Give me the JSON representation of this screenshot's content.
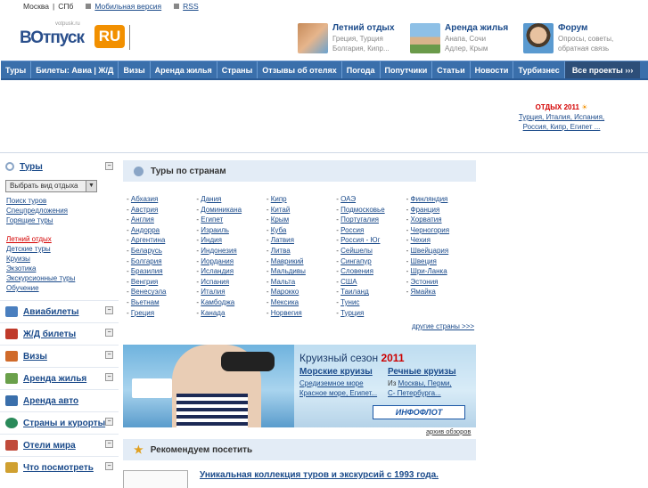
{
  "topbar": {
    "city": "Москва",
    "city_alt": "СПб",
    "mobile": "Мобильная версия",
    "rss": "RSS"
  },
  "logo": {
    "domain": "votpusk.ru",
    "word": "ВОтпуск",
    "box": "RU"
  },
  "promos": [
    {
      "title": "Летний отдых",
      "sub1": "Греция, Турция",
      "sub2": "Болгария, Кипр..."
    },
    {
      "title": "Аренда жилья",
      "sub1": "Анапа, Сочи",
      "sub2": "Адлер, Крым"
    },
    {
      "title": "Форум",
      "sub1": "Опросы, советы,",
      "sub2": "обратная связь"
    }
  ],
  "nav": [
    "Туры",
    "Билеты: Авиа | Ж/Д",
    "Визы",
    "Аренда жилья",
    "Страны",
    "Отзывы об отелях",
    "Погода",
    "Попутчики",
    "Статьи",
    "Новости",
    "Турбизнес"
  ],
  "nav_all": "Все проекты ›››",
  "ad": {
    "title": "ОТДЫХ 2011",
    "line1": "Турция, Италия, Испания,",
    "line2": "Россия, Кипр, Египет ..."
  },
  "sidebar": {
    "tours": "Туры",
    "select": "Выбрать вид отдыха",
    "links1": [
      "Поиск туров",
      "Спецпредложения",
      "Горящие туры"
    ],
    "links2": [
      "Летний отдых",
      "Детские туры",
      "Круизы",
      "Экзотика",
      "Экскурсионные туры",
      "Обучение"
    ],
    "sections": [
      "Авиабилеты",
      "Ж/Д билеты",
      "Визы",
      "Аренда жилья",
      "Аренда авто",
      "Страны и курорты",
      "Отели мира",
      "Что посмотреть"
    ]
  },
  "tours_panel": {
    "title": "Туры по странам",
    "columns": [
      [
        "Абхазия",
        "Австрия",
        "Англия",
        "Андорра",
        "Аргентина",
        "Беларусь",
        "Болгария",
        "Бразилия",
        "Венгрия",
        "Венесуэла",
        "Вьетнам",
        "Греция"
      ],
      [
        "Дания",
        "Доминикана",
        "Египет",
        "Израиль",
        "Индия",
        "Индонезия",
        "Иордания",
        "Исландия",
        "Испания",
        "Италия",
        "Камбоджа",
        "Канада"
      ],
      [
        "Кипр",
        "Китай",
        "Крым",
        "Куба",
        "Латвия",
        "Литва",
        "Маврикий",
        "Мальдивы",
        "Мальта",
        "Марокко",
        "Мексика",
        "Норвегия"
      ],
      [
        "ОАЭ",
        "Подмосковье",
        "Португалия",
        "Россия",
        "Россия - Юг",
        "Сейшелы",
        "Сингапур",
        "Словения",
        "США",
        "Таиланд",
        "Тунис",
        "Турция"
      ],
      [
        "Финляндия",
        "Франция",
        "Хорватия",
        "Черногория",
        "Чехия",
        "Швейцария",
        "Швеция",
        "Шри-Ланка",
        "Эстония",
        "Ямайка"
      ]
    ],
    "more": "другие страны >>>"
  },
  "banner": {
    "title": "Круизный сезон",
    "year": "2011",
    "sea_title": "Морские круизы",
    "sea1": "Средиземное море",
    "sea2": "Красное море, Египет...",
    "river_title": "Речные круизы",
    "river1_pre": "Из",
    "river1": "Москвы, Перми,",
    "river2": "С- Петербурга...",
    "logo": "ИНФОФЛОТ"
  },
  "archive": "архив обзоров",
  "rec": {
    "title": "Рекомендуем посетить",
    "headline": "Уникальная коллекция туров и экскурсий с 1993 года."
  },
  "colors": {
    "nav": "#3a6fab",
    "accent": "#f29000",
    "link": "#1a4a8a"
  }
}
